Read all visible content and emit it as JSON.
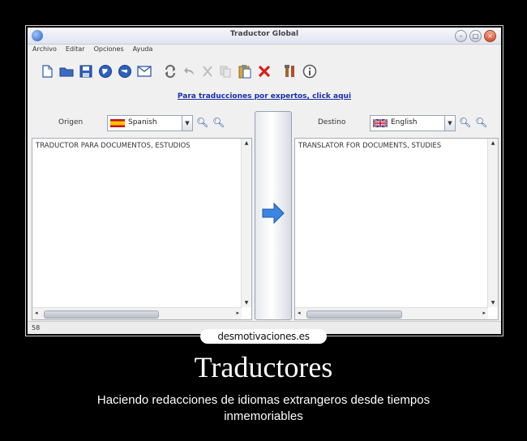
{
  "window": {
    "title": "Traductor Global",
    "min_glyph": "–",
    "max_glyph": "□",
    "close_glyph": "×"
  },
  "menu": {
    "items": [
      "Archivo",
      "Editar",
      "Opciones",
      "Ayuda"
    ]
  },
  "toolbar": {
    "icons": [
      "new-document-icon",
      "open-folder-icon",
      "save-icon",
      "globe-icon",
      "globe-2-icon",
      "email-icon",
      "refresh-icon",
      "undo-icon",
      "cut-icon",
      "copy-icon",
      "paste-icon",
      "delete-icon",
      "tools-icon",
      "info-icon"
    ]
  },
  "link": {
    "text": "Para traducciones por expertos, click aqui"
  },
  "source": {
    "label": "Origen",
    "language": "Spanish",
    "text": "TRADUCTOR PARA DOCUMENTOS, ESTUDIOS"
  },
  "target": {
    "label": "Destino",
    "language": "English",
    "text": "TRANSLATOR FOR DOCUMENTS, STUDIES"
  },
  "status": {
    "count": "58"
  },
  "poster": {
    "watermark": "desmotivaciones.es",
    "title": "Traductores",
    "subtitle": "Haciendo redacciones de idiomas extrangeros desde tiempos inmemoriables"
  },
  "colors": {
    "link": "#1a2ea8",
    "arrow": "#3a86e0",
    "delete": "#d8201c"
  }
}
